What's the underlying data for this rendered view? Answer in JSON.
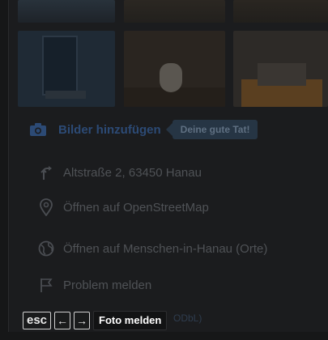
{
  "photos": {
    "items": [
      {
        "name": "entrance-door-photo"
      },
      {
        "name": "toilet-photo"
      },
      {
        "name": "accessible-room-photo"
      }
    ]
  },
  "actions": {
    "add_images_label": "Bilder hinzufügen",
    "good_deed_badge": "Deine gute Tat!"
  },
  "details": {
    "address": "Altstraße 2, 63450 Hanau",
    "open_osm": "Öffnen auf OpenStreetMap",
    "open_mih": "Öffnen auf Menschen-in-Hanau (Orte)",
    "report_problem": "Problem melden"
  },
  "bottom_bar": {
    "esc_key": "esc",
    "prev_key": "←",
    "next_key": "→",
    "report_photo": "Foto melden",
    "faint_text": "ODbL)"
  },
  "colors": {
    "accent": "#2c4a75",
    "badge_bg": "#263544",
    "background": "#1b1c1e"
  },
  "icons": [
    "camera-icon",
    "direction-icon",
    "location-pin-icon",
    "globe-icon",
    "flag-icon",
    "arrow-left-icon",
    "arrow-right-icon"
  ]
}
